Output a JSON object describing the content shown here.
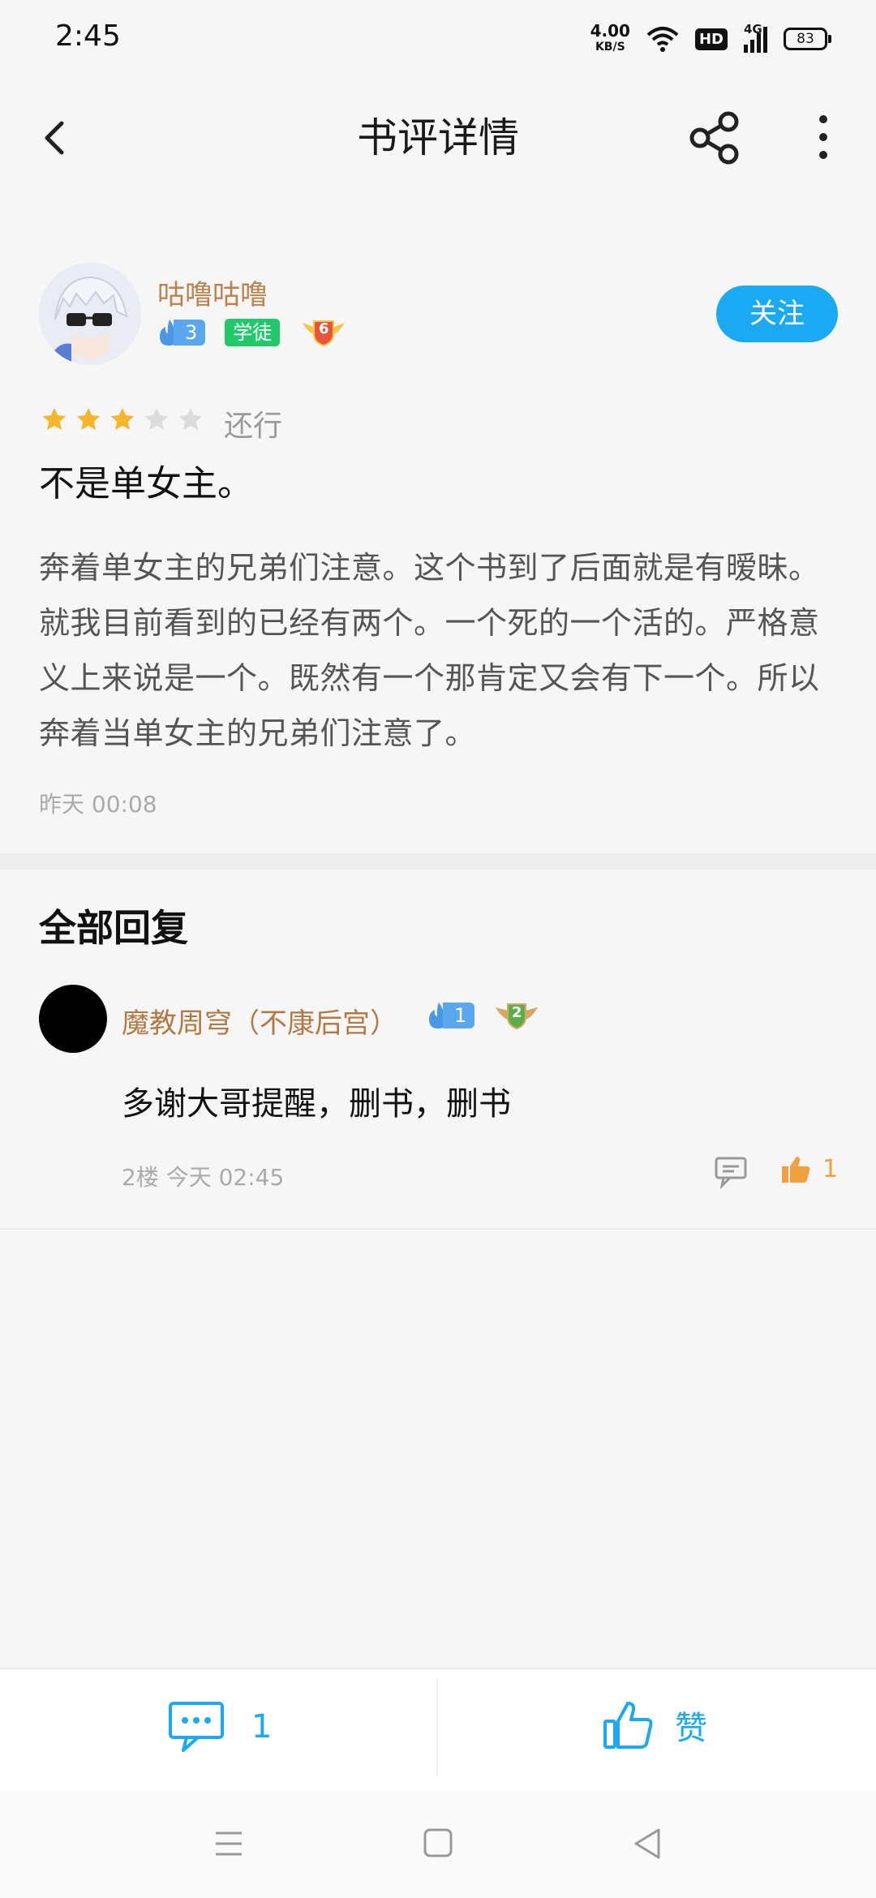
{
  "status_bar": {
    "time": "2:45",
    "net_speed": "4.00",
    "net_unit": "KB/S",
    "hd": "HD",
    "signal": "4G",
    "battery": "83"
  },
  "header": {
    "title": "书评详情",
    "icons": [
      "back-icon",
      "share-icon",
      "more-icon"
    ]
  },
  "review": {
    "author": {
      "name": "咕噜咕噜",
      "fire_level": "3",
      "tag": "学徒",
      "medal_level": "6"
    },
    "follow_label": "关注",
    "rating": {
      "stars": 3,
      "max": 5,
      "label": "还行"
    },
    "title": "不是单女主。",
    "body": "奔着单女主的兄弟们注意。这个书到了后面就是有暧昧。就我目前看到的已经有两个。一个死的一个活的。严格意义上来说是一个。既然有一个那肯定又会有下一个。所以奔着当单女主的兄弟们注意了。",
    "time": "昨天 00:08"
  },
  "replies": {
    "heading": "全部回复",
    "items": [
      {
        "name": "魔教周穹（不康后宫）",
        "fire_level": "1",
        "medal_level": "2",
        "text": "多谢大哥提醒，删书，删书",
        "meta": "2楼 今天 02:45",
        "like_count": "1"
      }
    ]
  },
  "actions": {
    "comment_count": "1",
    "like_label": "赞"
  },
  "colors": {
    "accent": "#1aa9f2",
    "author_name": "#b8834e",
    "star": "#f7b52c",
    "like": "#f0a040"
  }
}
